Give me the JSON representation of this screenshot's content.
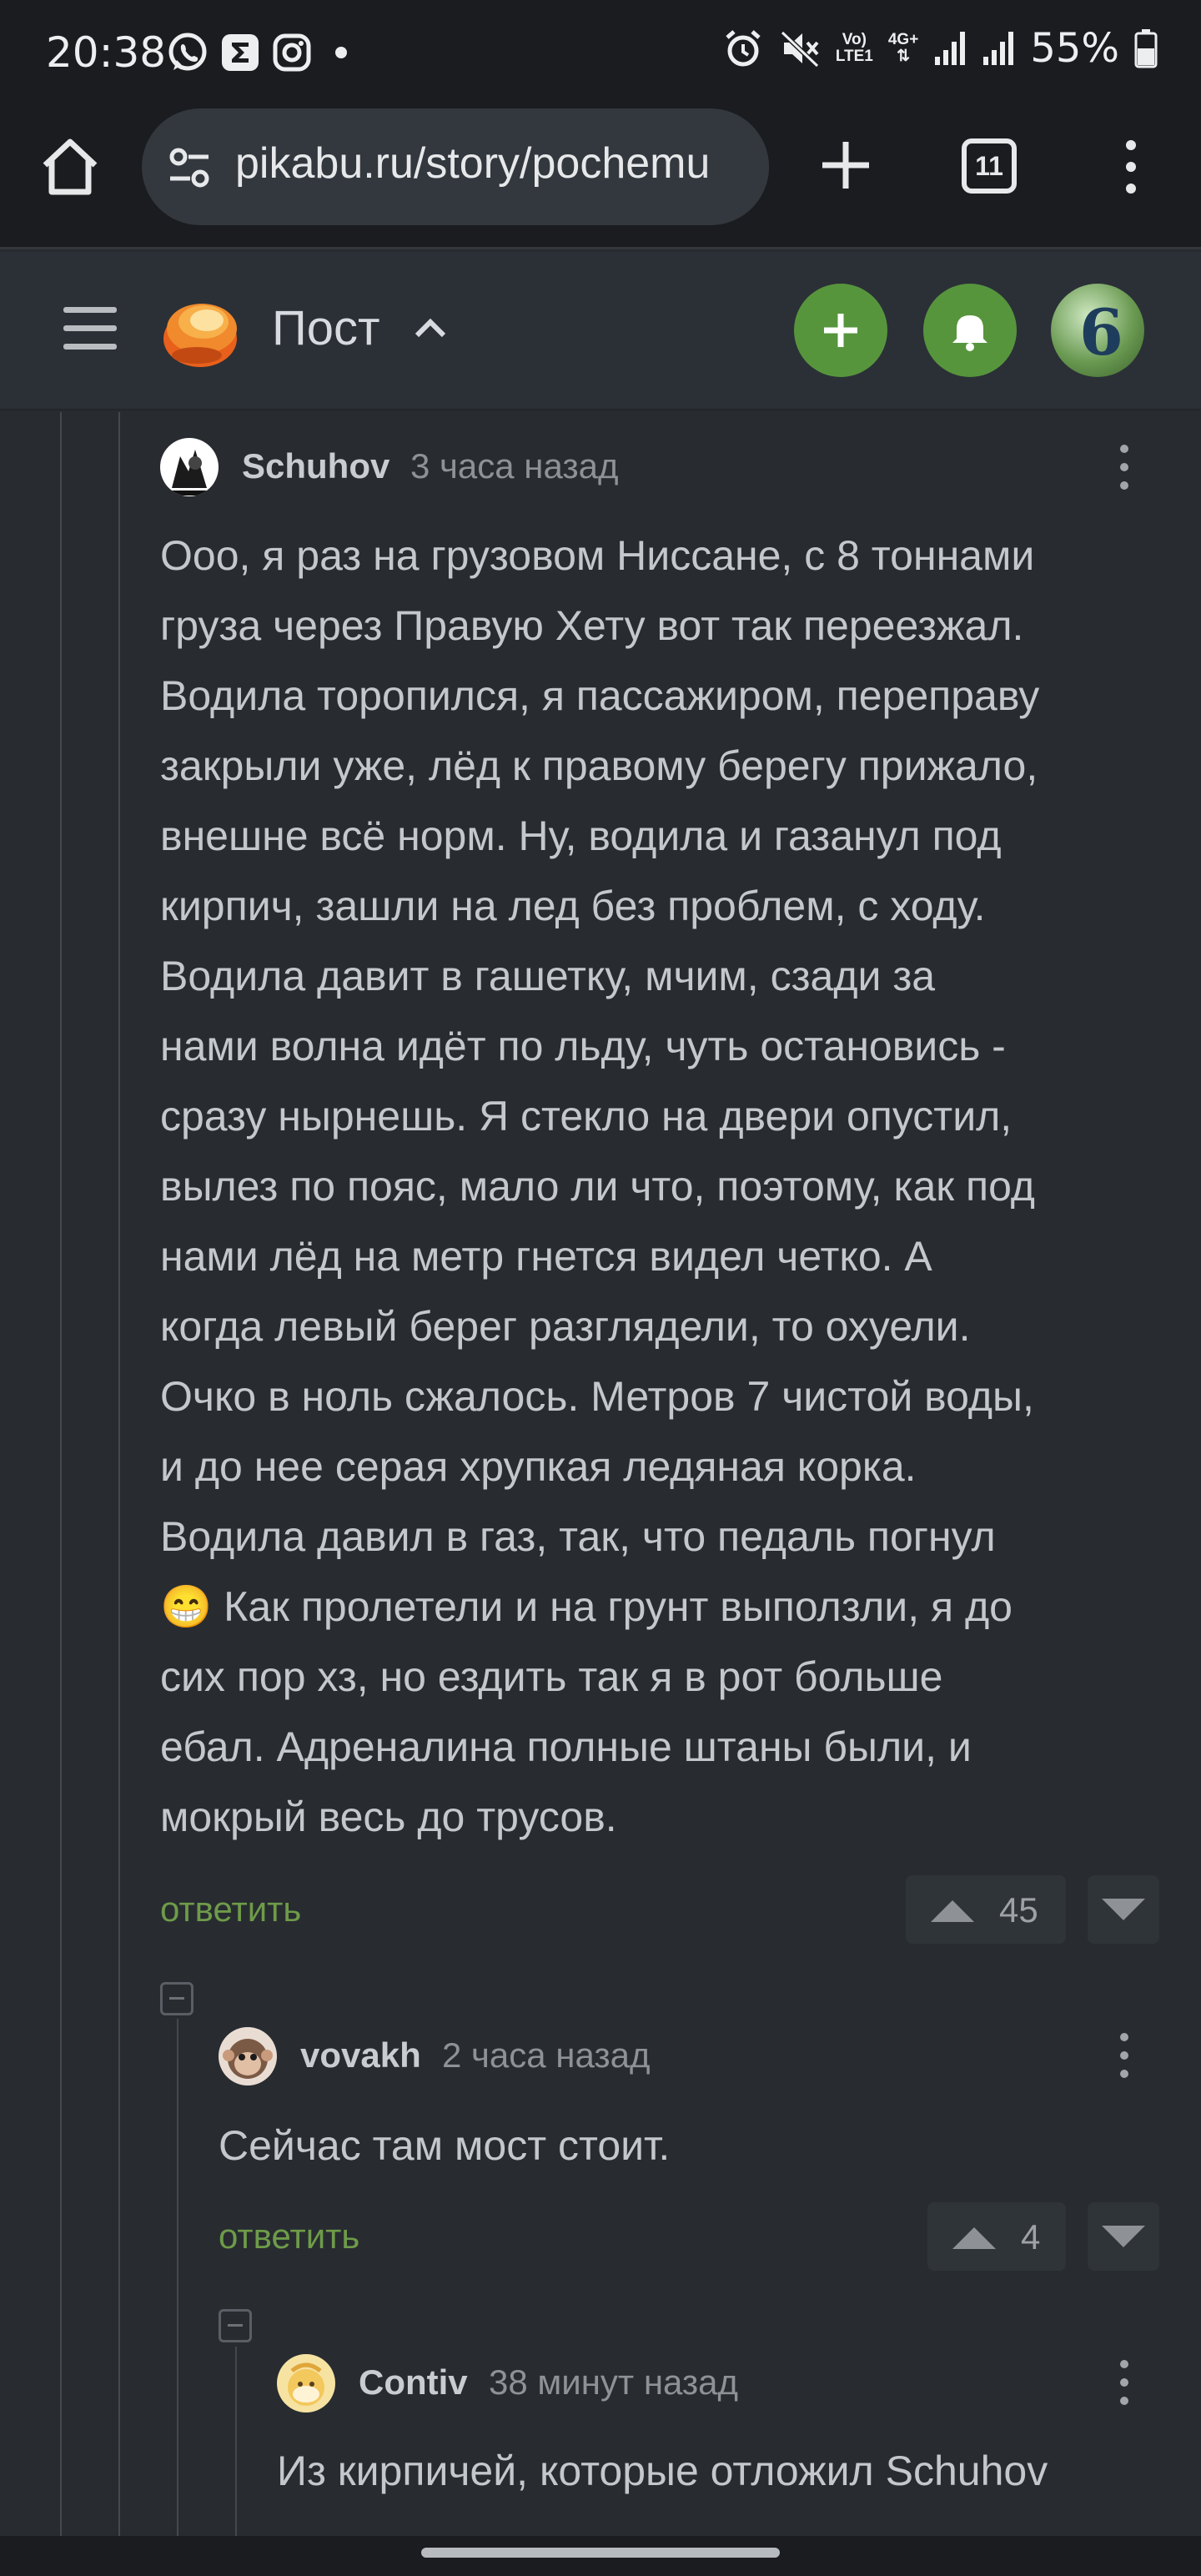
{
  "status_bar": {
    "time": "20:38",
    "left_icons": [
      "whatsapp-icon",
      "sigma-icon",
      "instagram-icon",
      "dot-icon"
    ],
    "network_top": "Vo)",
    "network_bottom": "LTE1",
    "network_type": "4G+",
    "battery": "55%"
  },
  "browser": {
    "url": "pikabu.ru/story/pochemu",
    "tab_count": "11"
  },
  "header": {
    "title": "Пост"
  },
  "comments": [
    {
      "author": "Schuhov",
      "time": "3 часа назад",
      "lines": [
        "Ооо, я раз на грузовом Ниссане, с 8 тоннами",
        "груза через Правую Хету вот так переезжал.",
        "Водила торопился, я пассажиром, переправу",
        "закрыли уже, лёд к правому берегу прижало,",
        "внешне всё норм. Ну, водила и газанул под",
        "кирпич, зашли на лед без проблем, с ходу.",
        "Водила давит в гашетку, мчим, сзади за",
        "нами волна идёт по льду, чуть остановись -",
        "сразу нырнешь. Я стекло на двери опустил,",
        "вылез по пояс, мало ли что, поэтому, как под",
        "нами лёд на метр гнется видел четко. А",
        "когда левый берег разглядели, то охуели.",
        "Очко в ноль сжалось. Метров 7 чистой воды,",
        "и до нее серая хрупкая ледяная корка.",
        "Водила давил в газ, так, что педаль погнул",
        "😁 Как пролетели и на грунт выползли, я до",
        "сих пор хз, но ездить так я в рот больше",
        "ебал. Адреналина полные штаны были, и",
        "мокрый весь до трусов."
      ],
      "reply": "ответить",
      "votes": "45"
    },
    {
      "author": "vovakh",
      "time": "2 часа назад",
      "lines": [
        "Сейчас там мост стоит."
      ],
      "reply": "ответить",
      "votes": "4"
    },
    {
      "author": "Contiv",
      "time": "38 минут назад",
      "lines": [
        "Из кирпичей, которые отложил Schuhov"
      ]
    }
  ],
  "colors": {
    "accent_green": "#57953d",
    "reply_green": "#6e9b49",
    "background": "#282c31"
  }
}
